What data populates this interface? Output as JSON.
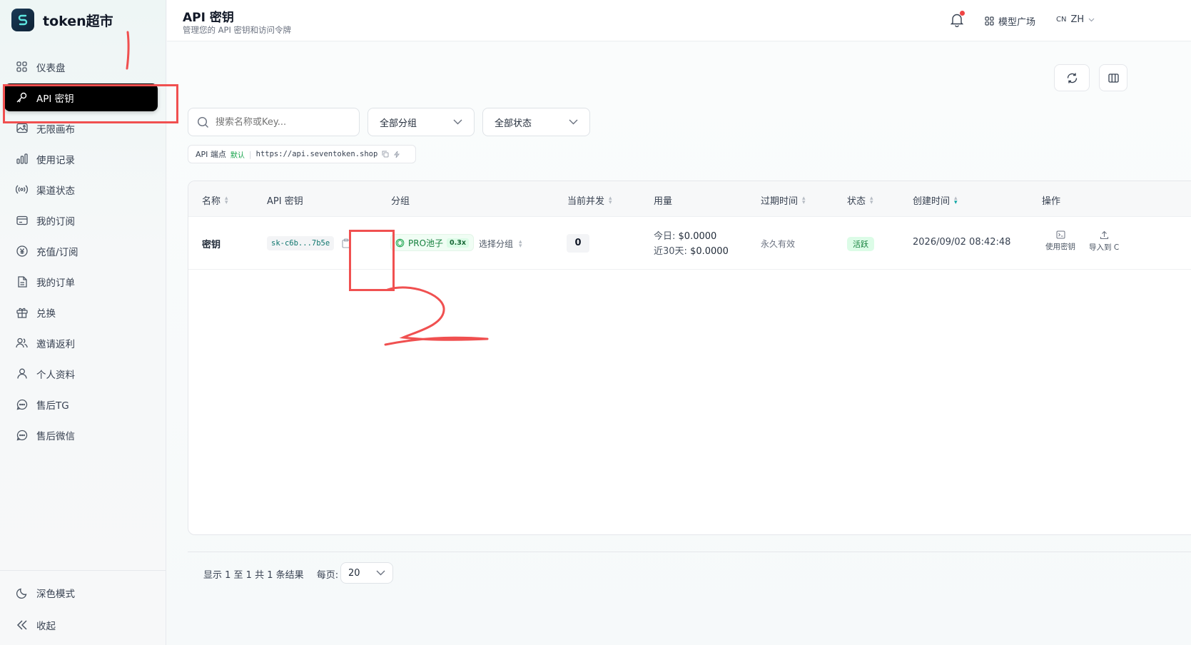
{
  "brand": {
    "name": "token超市"
  },
  "sidebar": {
    "items": [
      {
        "label": "仪表盘",
        "icon": "dashboard-icon"
      },
      {
        "label": "API 密钥",
        "icon": "key-icon",
        "active": true
      },
      {
        "label": "无限画布",
        "icon": "image-icon"
      },
      {
        "label": "使用记录",
        "icon": "bar-chart-icon"
      },
      {
        "label": "渠道状态",
        "icon": "broadcast-icon"
      },
      {
        "label": "我的订阅",
        "icon": "card-icon"
      },
      {
        "label": "充值/订阅",
        "icon": "yen-icon"
      },
      {
        "label": "我的订单",
        "icon": "document-icon"
      },
      {
        "label": "兑换",
        "icon": "gift-icon"
      },
      {
        "label": "邀请返利",
        "icon": "users-icon"
      },
      {
        "label": "个人资料",
        "icon": "user-icon"
      },
      {
        "label": "售后TG",
        "icon": "chat-icon"
      },
      {
        "label": "售后微信",
        "icon": "chat-icon"
      }
    ],
    "bottom": [
      {
        "label": "深色模式",
        "icon": "moon-icon"
      },
      {
        "label": "收起",
        "icon": "collapse-icon"
      }
    ]
  },
  "header": {
    "title": "API 密钥",
    "subtitle": "管理您的 API 密钥和访问令牌",
    "models_label": "模型广场",
    "lang_prefix": "CN",
    "lang": "ZH"
  },
  "filters": {
    "search_placeholder": "搜索名称或Key...",
    "group_select": "全部分组",
    "status_select": "全部状态"
  },
  "endpoint": {
    "label": "API 端点",
    "badge": "默认",
    "url": "https://api.seventoken.shop"
  },
  "table": {
    "columns": [
      "名称",
      "API 密钥",
      "分组",
      "当前并发",
      "用量",
      "过期时间",
      "状态",
      "创建时间",
      "操作"
    ],
    "rows": [
      {
        "name": "密钥",
        "key": "sk-c6b...7b5e",
        "group": "PRO池子",
        "multiplier": "0.3x",
        "group_action": "选择分组",
        "concurrent": "0",
        "usage_today_label": "今日:",
        "usage_today": "$0.0000",
        "usage_30d_label": "近30天:",
        "usage_30d": "$0.0000",
        "expires": "永久有效",
        "status": "活跃",
        "created": "2026/09/02 08:42:48",
        "actions": [
          "使用密钥",
          "导入到 C"
        ]
      }
    ]
  },
  "pagination": {
    "summary": "显示 1 至 1 共 1 条结果",
    "per_page_label": "每页:",
    "per_page": "20"
  },
  "annotation": {
    "mark": "2"
  },
  "colors": {
    "accent": "#0ea5a4",
    "active_nav": "#000000",
    "annotation": "#f05050",
    "status": "#15803d"
  }
}
